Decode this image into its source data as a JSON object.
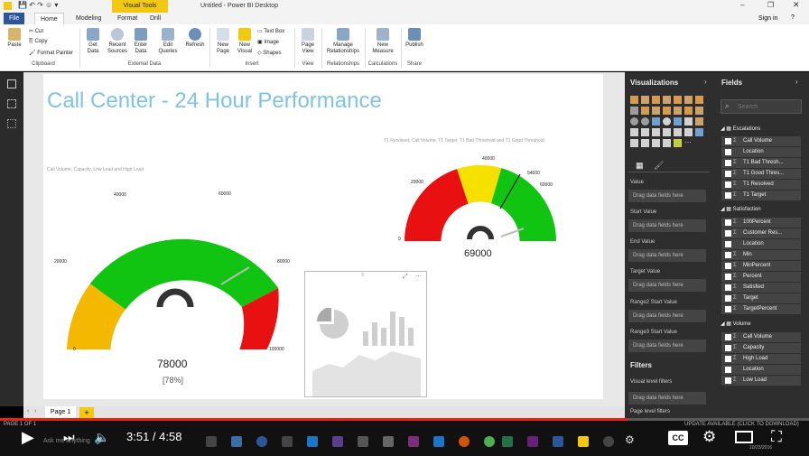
{
  "window": {
    "title": "Untitled - Power BI Desktop",
    "contextual_tab": "Visual Tools",
    "sign_in": "Sign in"
  },
  "ribbon": {
    "tabs": [
      "File",
      "Home",
      "Modeling",
      "Format",
      "Drill"
    ],
    "clipboard": {
      "paste": "Paste",
      "cut": "Cut",
      "copy": "Copy",
      "format_painter": "Format Painter",
      "group": "Clipboard"
    },
    "external": {
      "get_data": "Get Data",
      "recent_sources": "Recent Sources",
      "enter_data": "Enter Data",
      "edit_queries": "Edit Queries",
      "refresh": "Refresh",
      "group": "External Data"
    },
    "insert": {
      "new_page": "New Page",
      "new_visual": "New Visual",
      "text_box": "Text Box",
      "image": "Image",
      "shapes": "Shapes",
      "group": "Insert"
    },
    "view": {
      "page_view": "Page View",
      "group": "View"
    },
    "relationships": {
      "manage": "Manage Relationships",
      "group": "Relationships"
    },
    "calculations": {
      "new_measure": "New Measure",
      "group": "Calculations"
    },
    "share": {
      "publish": "Publish",
      "group": "Share"
    }
  },
  "report": {
    "title": "Call Center - 24 Hour Performance",
    "gauge1": {
      "caption": "Call Volume, Capacity, Low Load and High Load",
      "ticks": [
        "0",
        "20000",
        "40000",
        "60000",
        "80000",
        "100000"
      ],
      "value_label": "78000",
      "percent_label": "[78%]",
      "colors": {
        "low": "#f5b800",
        "mid": "#11c411",
        "high": "#e81010"
      }
    },
    "gauge2": {
      "caption": "T1 Resolved, Call Volume, T1 Target, T1 Bad Threshold and T1 Good Threshold",
      "ticks": [
        "0",
        "20000",
        "40000",
        "54600",
        "60000"
      ],
      "value_label": "69000",
      "colors": {
        "bad": "#e81010",
        "mid": "#f5e000",
        "good": "#11c411"
      }
    },
    "page_tab": "Page 1",
    "add_page": "+"
  },
  "visualizations": {
    "title": "Visualizations",
    "wells": [
      {
        "label": "Value",
        "drop": "Drag data fields here"
      },
      {
        "label": "Start Value",
        "drop": "Drag data fields here"
      },
      {
        "label": "End Value",
        "drop": "Drag data fields here"
      },
      {
        "label": "Target Value",
        "drop": "Drag data fields here"
      },
      {
        "label": "Range2 Start Value",
        "drop": "Drag data fields here"
      },
      {
        "label": "Range3 Start Value",
        "drop": "Drag data fields here"
      }
    ],
    "filters_title": "Filters",
    "visual_filters": "Visual level filters",
    "visual_filters_drop": "Drag data fields here",
    "page_filters": "Page level filters"
  },
  "fields": {
    "title": "Fields",
    "search_placeholder": "Search",
    "tables": [
      {
        "name": "Escalations",
        "items": [
          {
            "name": "Call Volume",
            "sigma": true
          },
          {
            "name": "Location",
            "sigma": false
          },
          {
            "name": "T1 Bad Thresh...",
            "sigma": true
          },
          {
            "name": "T1 Good Thres...",
            "sigma": true
          },
          {
            "name": "T1 Resolved",
            "sigma": true
          },
          {
            "name": "T1 Target",
            "sigma": true
          }
        ]
      },
      {
        "name": "Satisfaction",
        "items": [
          {
            "name": "100Percent",
            "sigma": true
          },
          {
            "name": "Customer Res...",
            "sigma": true
          },
          {
            "name": "Location",
            "sigma": false
          },
          {
            "name": "Min",
            "sigma": true
          },
          {
            "name": "MinPercent",
            "sigma": true
          },
          {
            "name": "Percent",
            "sigma": true
          },
          {
            "name": "Satisfied",
            "sigma": true
          },
          {
            "name": "Target",
            "sigma": true
          },
          {
            "name": "TargetPercent",
            "sigma": true
          }
        ]
      },
      {
        "name": "Volume",
        "items": [
          {
            "name": "Call Volume",
            "sigma": true
          },
          {
            "name": "Capacity",
            "sigma": true
          },
          {
            "name": "High Load",
            "sigma": true
          },
          {
            "name": "Location",
            "sigma": false
          },
          {
            "name": "Low Load",
            "sigma": true
          }
        ]
      }
    ]
  },
  "player": {
    "time": "3:51 / 4:58",
    "progress": 0.776,
    "page_status": "PAGE 1 OF 1",
    "update_notice": "UPDATE AVAILABLE (CLICK TO DOWNLOAD)",
    "ask": "Ask me anything",
    "date": "10/23/2016",
    "cc": "CC"
  }
}
